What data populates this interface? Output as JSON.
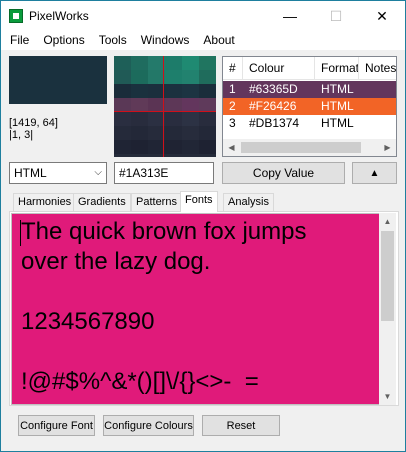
{
  "app": {
    "title": "PixelWorks"
  },
  "window_controls": {
    "minimize": "—",
    "maximize": "☐",
    "close": "✕"
  },
  "menu": [
    "File",
    "Options",
    "Tools",
    "Windows",
    "About"
  ],
  "swatch": {
    "color": "#1A313E"
  },
  "cursor": {
    "position": "[1419, 64]",
    "cell": "|1, 3|"
  },
  "zoom": {
    "cells": [
      [
        "#1e5f58",
        "#1f6c5f",
        "#247a6b",
        "#1d7c6a",
        "#1f8a72",
        "#207560"
      ],
      [
        "#205a56",
        "#1c6b5c",
        "#237868",
        "#1e7f6c",
        "#22826f",
        "#1f6c5c"
      ],
      [
        "#1a2c3a",
        "#1a313e",
        "#1b2f3d",
        "#1b313f",
        "#1c3442",
        "#1a2d3b"
      ],
      [
        "#5a3856",
        "#603a58",
        "#5b3454",
        "#5d3757",
        "#63365d",
        "#5f3a5b"
      ],
      [
        "#2a2e40",
        "#282c3d",
        "#2b3042",
        "#292d3f",
        "#2c3244",
        "#282c3d"
      ],
      [
        "#252a3a",
        "#232838",
        "#262b3b",
        "#242939",
        "#272c3c",
        "#232838"
      ],
      [
        "#1f2434",
        "#1e2232",
        "#202535",
        "#1f2333",
        "#212636",
        "#1e2232"
      ]
    ]
  },
  "colour_table": {
    "headers": [
      "#",
      "Colour",
      "Format",
      "Notes"
    ],
    "rows": [
      {
        "num": "1",
        "colour": "#63365D",
        "format": "HTML",
        "bg": "#63365d",
        "fg": "#ffffff"
      },
      {
        "num": "2",
        "colour": "#F26426",
        "format": "HTML",
        "bg": "#f26426",
        "fg": "#ffffff"
      },
      {
        "num": "3",
        "colour": "#DB1374",
        "format": "HTML",
        "bg": "#ffffff",
        "fg": "#000000"
      }
    ]
  },
  "controls": {
    "format_value": "HTML",
    "hex_value": "#1A313E",
    "copy_label": "Copy Value",
    "up_label": "▲"
  },
  "tabs": [
    "Harmonies",
    "Gradients",
    "Patterns",
    "Fonts",
    "Analysis"
  ],
  "active_tab": "Fonts",
  "preview": {
    "text": "The quick brown fox jumps\nover the lazy dog.\n\n1234567890\n\n!@#$%^&*()[]\\/{}<>-  =",
    "background": "#E01A7A"
  },
  "buttons": {
    "configure_font": "Configure Font",
    "configure_colours": "Configure Colours",
    "reset": "Reset"
  }
}
